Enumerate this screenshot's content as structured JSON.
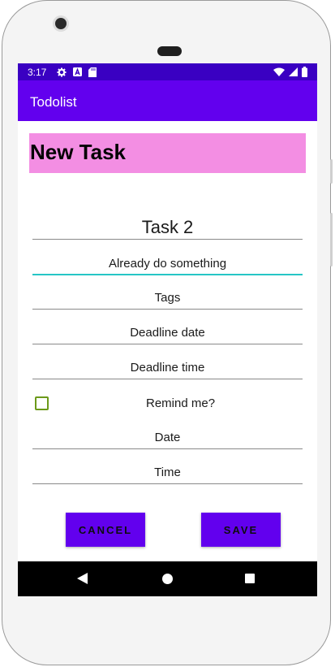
{
  "status_bar": {
    "time": "3:17",
    "icons_left": [
      "gear-icon",
      "a-badge-icon",
      "sd-card-icon"
    ],
    "icons_right": [
      "wifi-icon",
      "signal-icon",
      "battery-icon"
    ]
  },
  "app_bar": {
    "title": "Todolist"
  },
  "heading": "New Task",
  "fields": {
    "title_value": "Task 2",
    "description_value": "Already do something",
    "tags_placeholder": "Tags",
    "deadline_date_placeholder": "Deadline date",
    "deadline_time_placeholder": "Deadline time",
    "remind_label": "Remind me?",
    "remind_checked": false,
    "remind_date_placeholder": "Date",
    "remind_time_placeholder": "Time"
  },
  "buttons": {
    "cancel": "CANCEL",
    "save": "SAVE"
  },
  "colors": {
    "status_bar": "#3a00c2",
    "primary": "#6200ee",
    "heading_background": "#f38ee3",
    "focus_underline": "#26c6c6",
    "checkbox": "#6c9a1a"
  },
  "nav_bar": {
    "icons": [
      "back-icon",
      "home-icon",
      "recents-icon"
    ]
  }
}
